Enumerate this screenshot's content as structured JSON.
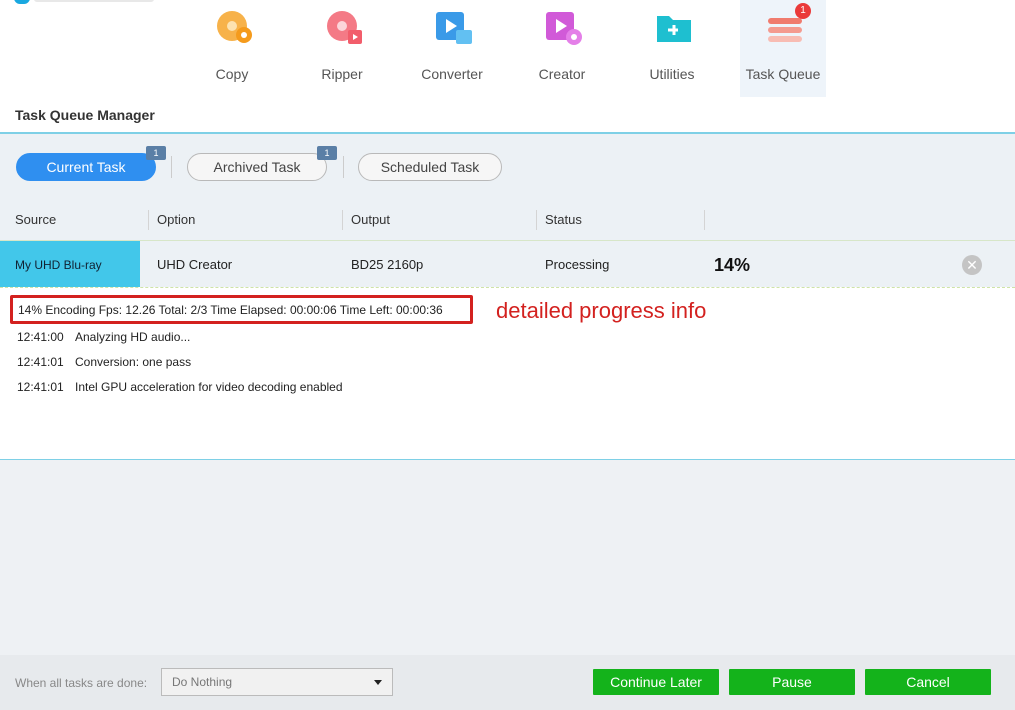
{
  "toolbar": {
    "tools": [
      {
        "label": "Copy",
        "icon": "copy-disc-icon"
      },
      {
        "label": "Ripper",
        "icon": "ripper-disc-icon"
      },
      {
        "label": "Converter",
        "icon": "converter-film-icon"
      },
      {
        "label": "Creator",
        "icon": "creator-disc-icon"
      },
      {
        "label": "Utilities",
        "icon": "utilities-folder-icon"
      },
      {
        "label": "Task Queue",
        "icon": "task-queue-icon",
        "badge": "1"
      }
    ]
  },
  "section_title": "Task Queue Manager",
  "tabs": [
    {
      "label": "Current Task",
      "badge": "1"
    },
    {
      "label": "Archived Task",
      "badge": "1"
    },
    {
      "label": "Scheduled Task"
    }
  ],
  "columns": [
    "Source",
    "Option",
    "Output",
    "Status"
  ],
  "task": {
    "source": "My UHD Blu-ray",
    "option": "UHD Creator",
    "output": "BD25 2160p",
    "status": "Processing",
    "percent": "14%"
  },
  "progress_info": "14%  Encoding Fps: 12.26   Total: 2/3  Time Elapsed: 00:00:06  Time Left: 00:00:36",
  "annotation": "detailed progress info",
  "logs": [
    {
      "time": "12:41:00",
      "text": "Analyzing HD audio..."
    },
    {
      "time": "12:41:01",
      "text": "Conversion: one pass"
    },
    {
      "time": "12:41:01",
      "text": "Intel GPU acceleration for video decoding enabled"
    }
  ],
  "footer": {
    "label": "When all tasks are done:",
    "select_value": "Do Nothing",
    "buttons": {
      "continue": "Continue Later",
      "pause": "Pause",
      "cancel": "Cancel"
    }
  },
  "colors": {
    "accent": "#2f8ff0",
    "highlight_row": "#42c7ea",
    "green_button": "#14b31b",
    "annotation_red": "#d3211f"
  }
}
